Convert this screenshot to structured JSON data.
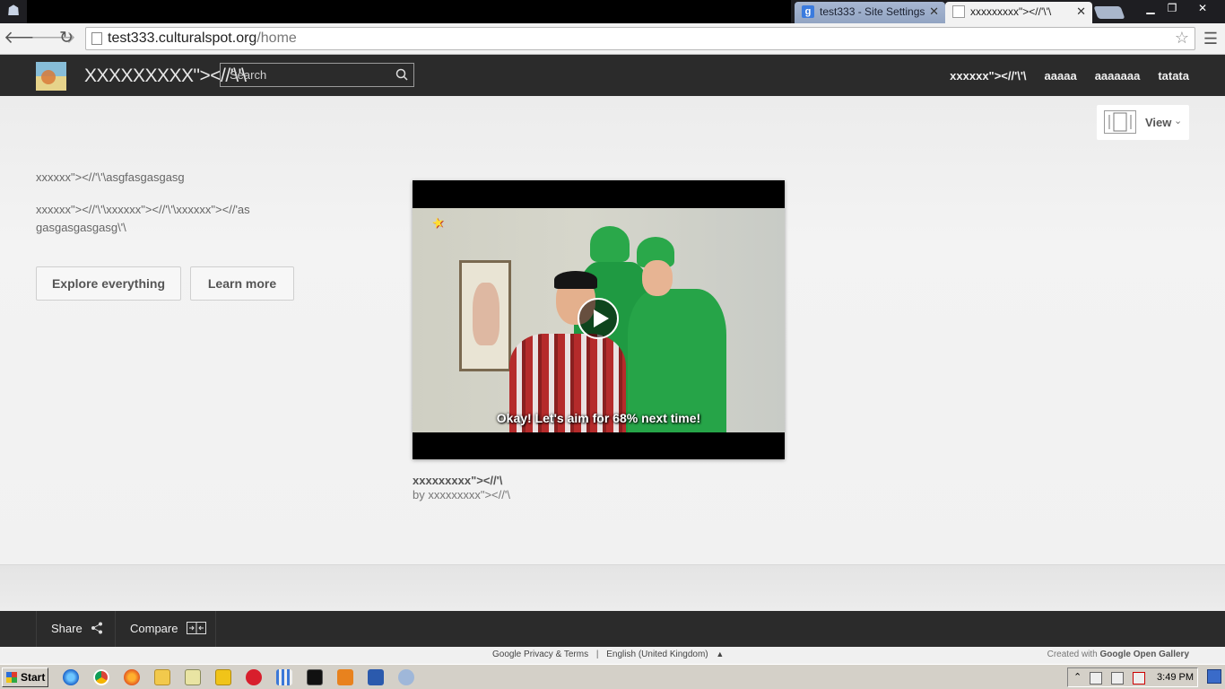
{
  "browser": {
    "tabs": [
      {
        "label": "test333 - Site Settings",
        "favicon": "google-g-icon",
        "active": false
      },
      {
        "label": "xxxxxxxxx\"><//'\\'\\",
        "favicon": "page-icon",
        "active": true
      }
    ],
    "url_host": "test333.culturalspot.org",
    "url_path": "/home"
  },
  "header": {
    "site_title": "XXXXXXXXX\"><//'\\'\\",
    "search_placeholder": "Search",
    "nav": [
      "xxxxxx\"><//'\\'\\",
      "aaaaa",
      "aaaaaaa",
      "tatata"
    ]
  },
  "view_control": {
    "label": "View",
    "icon": "view-layout-icon"
  },
  "intro": {
    "line1": "xxxxxx\"><//'\\'\\asgfasgasgasg",
    "line2": "xxxxxx\"><//'\\'\\xxxxxx\"><//'\\'\\xxxxxx\"><//'asgasgasgasgasg\\'\\"
  },
  "buttons": {
    "explore": "Explore everything",
    "learn": "Learn more"
  },
  "video": {
    "subtitle": "Okay! Let's aim for 68% next time!",
    "title": "xxxxxxxxx\"><//'\\",
    "author": "by xxxxxxxxx\"><//'\\"
  },
  "footer": {
    "share": "Share",
    "compare": "Compare",
    "privacy": "Google Privacy & Terms",
    "language": "English (United Kingdom)",
    "created_prefix": "Created with",
    "created_brand": "Google Open Gallery"
  },
  "taskbar": {
    "start": "Start",
    "clock": "3:49 PM"
  }
}
